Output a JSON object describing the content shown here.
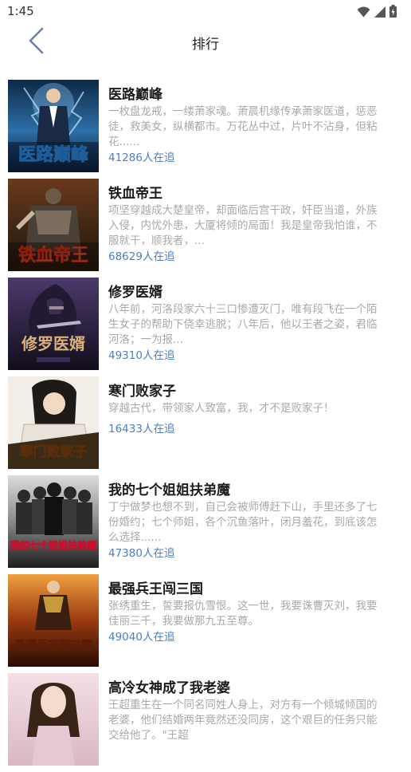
{
  "status_bar": {
    "time": "1:45"
  },
  "header": {
    "title": "排行"
  },
  "colors": {
    "accent": "#4a7fc1",
    "back_icon": "#6b7fb0"
  },
  "books": [
    {
      "title": "医路巅峰",
      "cover_text": "医路巅峰",
      "desc": "一枚盘龙戒，一缕萧家魂。萧晨机缘传承萧家医道，惩恶徒，救美女，纵横都市。万花丛中过，片叶不沾身，但粘花......",
      "followers": "41286人在追"
    },
    {
      "title": "铁血帝王",
      "cover_text": "铁血帝王",
      "desc": "项坚穿越成大楚皇帝，却面临后宫干政，奸臣当道，外族入侵，内忧外患，大厦将倾的局面！我是皇帝我怕谁，不服就干，顺我者，...",
      "followers": "68629人在追"
    },
    {
      "title": "修罗医婿",
      "cover_text": "修罗医婿",
      "desc": "八年前，河洛段家六十三口惨遭灭门，唯有段飞在一个陌生女子的帮助下侥幸逃脱；八年后，他以王者之姿，君临河洛；一为报...",
      "followers": "49310人在追"
    },
    {
      "title": "寒门败家子",
      "cover_text": "寒门败家子",
      "desc": "穿越古代，带领家人致富，我，才不是败家子！",
      "followers": "16433人在追"
    },
    {
      "title": "我的七个姐姐扶弟魔",
      "cover_text": "我的七个姐姐扶弟魔",
      "desc": "丁宁做梦也想不到，自己会被师傅赶下山，手里还多了七份婚约；七个师姐，各个沉鱼落叶，闭月羞花，到底该怎么选择......",
      "followers": "47380人在追"
    },
    {
      "title": "最强兵王闯三国",
      "cover_text": "最强兵王闯三国",
      "desc": "张绣重生，誓要报仇雪恨。这一世，我要诛曹灭刘，我要佳丽三千，我要做那九五至尊。",
      "followers": "49040人在追"
    },
    {
      "title": "高冷女神成了我老婆",
      "cover_text": "",
      "desc": "王超重生在一个同名同姓人身上，对方有一个倾城倾国的老婆，他们结婚两年竟然还没同房，这个艰巨的任务只能交给他了。\"王超",
      "followers": ""
    }
  ]
}
